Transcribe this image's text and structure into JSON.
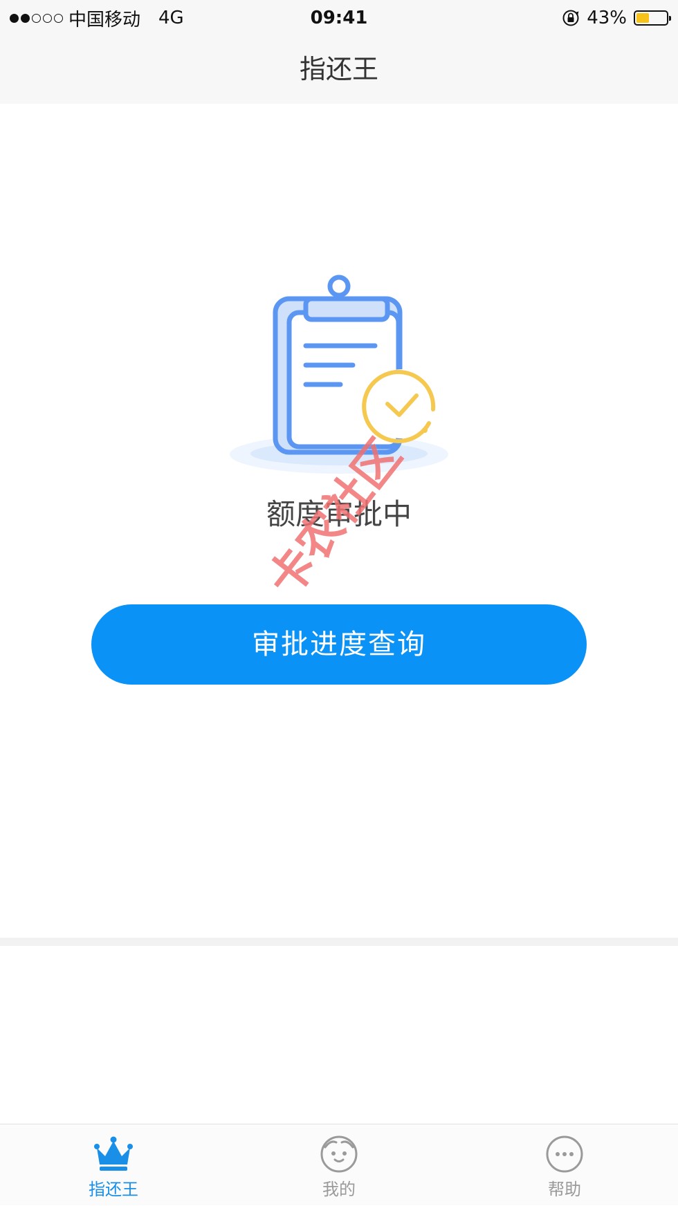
{
  "status_bar": {
    "carrier": "中国移动",
    "network": "4G",
    "time": "09:41",
    "battery_percent": "43%",
    "battery_level": 0.43,
    "signal_bars_filled": 2,
    "signal_bars_total": 5
  },
  "nav": {
    "title": "指还王"
  },
  "main": {
    "status_text": "额度审批中",
    "query_button_label": "审批进度查询",
    "illustration_icon": "clipboard-check-icon"
  },
  "watermark": {
    "text": "卡农社区"
  },
  "tabs": [
    {
      "label": "指还王",
      "icon": "crown-icon",
      "active": true
    },
    {
      "label": "我的",
      "icon": "face-icon",
      "active": false
    },
    {
      "label": "帮助",
      "icon": "more-dots-icon",
      "active": false
    }
  ],
  "colors": {
    "accent": "#0a92f7",
    "tab_active": "#1a8fe8",
    "tab_inactive": "#9a9a9a",
    "clipboard_blue": "#5b96f2",
    "check_yellow": "#f5c84f"
  }
}
